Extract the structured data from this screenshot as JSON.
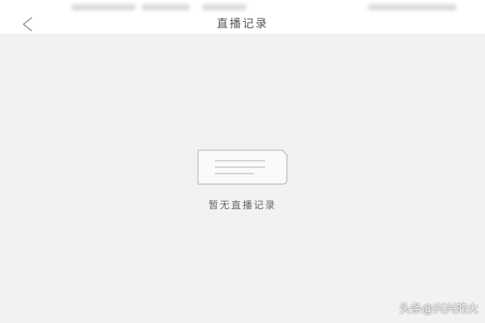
{
  "nav": {
    "title": "直播记录"
  },
  "empty_state": {
    "message": "暂无直播记录"
  },
  "watermark": {
    "text": "头条@兴兴的火"
  },
  "icons": {
    "back": "chevron-left-icon",
    "empty": "document-icon"
  },
  "colors": {
    "page_background": "#f2f2f2",
    "bar_background": "#ffffff",
    "icon_stroke": "#c8c8c8"
  }
}
